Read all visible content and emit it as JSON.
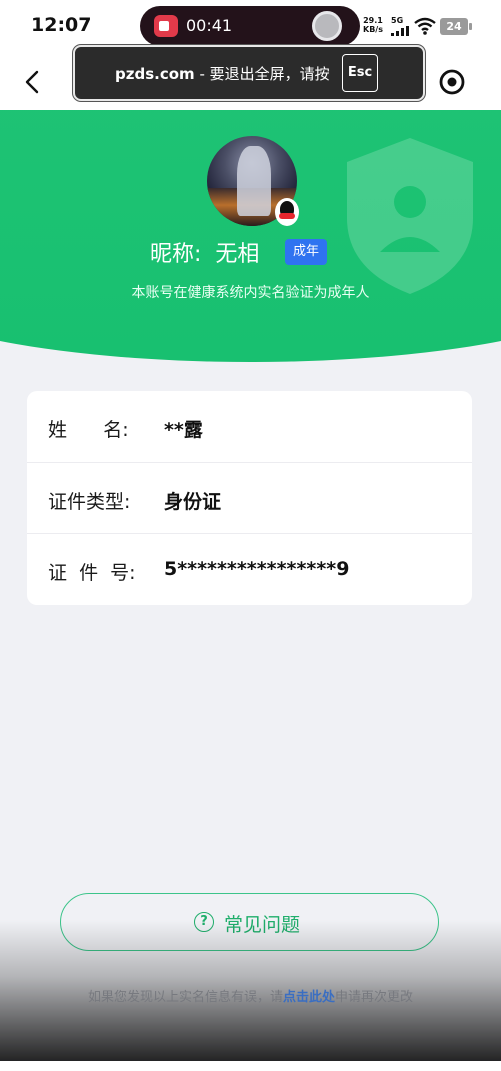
{
  "status_bar": {
    "time": "12:07",
    "recording_time": "00:41",
    "net_speed": "29.1",
    "net_unit": "KB/s",
    "network": "5G",
    "battery": "24"
  },
  "toast": {
    "site": "pzds.com",
    "message": " - 要退出全屏，请按",
    "key": "Esc"
  },
  "profile": {
    "nickname_label": "昵称:",
    "nickname": "无相",
    "badge": "成年",
    "subtitle": "本账号在健康系统内实名验证为成年人"
  },
  "info_rows": [
    {
      "label": "姓      名:",
      "value": "**露"
    },
    {
      "label": "证件类型:",
      "value": "身份证"
    },
    {
      "label": "证  件  号:",
      "value": "5****************9"
    }
  ],
  "faq": {
    "icon": "?",
    "label": "常见问题"
  },
  "footer": {
    "prefix": "如果您发现以上实名信息有误，请",
    "link": "点击此处",
    "suffix": "申请再次更改"
  },
  "colors": {
    "hero_green": "#1cc374",
    "badge_blue": "#2f73f0",
    "faq_green": "#1fae6b",
    "link_blue": "#3a6ec2"
  }
}
